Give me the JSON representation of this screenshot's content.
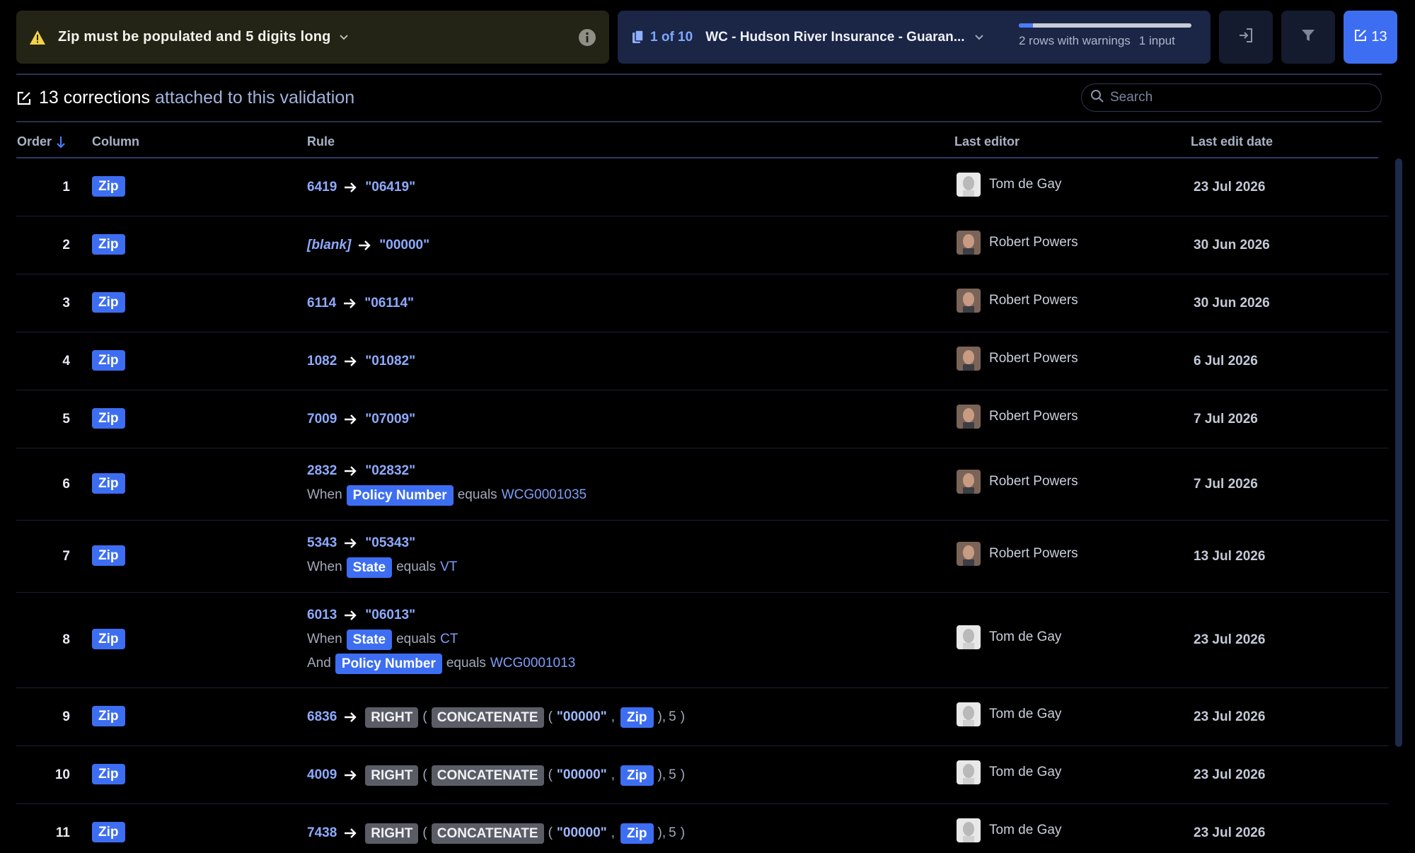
{
  "header": {
    "validation_message": "Zip must be populated and 5 digits long",
    "file_index": "1 of 10",
    "file_name": "WC - Hudson River Insurance - Guaran...",
    "progress_fraction": 0.08,
    "rows_with_warnings": "2 rows with warnings",
    "inputs": "1 input",
    "corrections_count": "13"
  },
  "subheader": {
    "count_text": "13 corrections",
    "rest_text": "attached to this validation",
    "search_placeholder": "Search"
  },
  "table": {
    "columns": {
      "order": "Order",
      "column": "Column",
      "rule": "Rule",
      "editor": "Last editor",
      "date": "Last edit date"
    },
    "rows": [
      {
        "order": "1",
        "column": "Zip",
        "from": "6419",
        "to": "\"06419\"",
        "editor": "Tom de Gay",
        "date": "23 Jul 2026"
      },
      {
        "order": "2",
        "column": "Zip",
        "from": "[blank]",
        "to": "\"00000\"",
        "editor": "Robert Powers",
        "date": "30 Jun 2026"
      },
      {
        "order": "3",
        "column": "Zip",
        "from": "6114",
        "to": "\"06114\"",
        "editor": "Robert Powers",
        "date": "30 Jun 2026"
      },
      {
        "order": "4",
        "column": "Zip",
        "from": "1082",
        "to": "\"01082\"",
        "editor": "Robert Powers",
        "date": "6 Jul 2026"
      },
      {
        "order": "5",
        "column": "Zip",
        "from": "7009",
        "to": "\"07009\"",
        "editor": "Robert Powers",
        "date": "7 Jul 2026"
      },
      {
        "order": "6",
        "column": "Zip",
        "from": "2832",
        "to": "\"02832\"",
        "when_word": "When",
        "when_field": "Policy Number",
        "when_op": "equals",
        "when_value": "WCG0001035",
        "editor": "Robert Powers",
        "date": "7 Jul 2026"
      },
      {
        "order": "7",
        "column": "Zip",
        "from": "5343",
        "to": "\"05343\"",
        "when_word": "When",
        "when_field": "State",
        "when_op": "equals",
        "when_value": "VT",
        "editor": "Robert Powers",
        "date": "13 Jul 2026"
      },
      {
        "order": "8",
        "column": "Zip",
        "from": "6013",
        "to": "\"06013\"",
        "when_word": "When",
        "when_field": "State",
        "when_op": "equals",
        "when_value": "CT",
        "and_word": "And",
        "and_field": "Policy Number",
        "and_op": "equals",
        "and_value": "WCG0001013",
        "editor": "Tom de Gay",
        "date": "23 Jul 2026"
      },
      {
        "order": "9",
        "column": "Zip",
        "from": "6836",
        "fn_outer": "RIGHT",
        "fn_inner": "CONCATENATE",
        "fn_str": "\"00000\"",
        "fn_field": "Zip",
        "fn_num": "5",
        "editor": "Tom de Gay",
        "date": "23 Jul 2026"
      },
      {
        "order": "10",
        "column": "Zip",
        "from": "4009",
        "fn_outer": "RIGHT",
        "fn_inner": "CONCATENATE",
        "fn_str": "\"00000\"",
        "fn_field": "Zip",
        "fn_num": "5",
        "editor": "Tom de Gay",
        "date": "23 Jul 2026"
      },
      {
        "order": "11",
        "column": "Zip",
        "from": "7438",
        "fn_outer": "RIGHT",
        "fn_inner": "CONCATENATE",
        "fn_str": "\"00000\"",
        "fn_field": "Zip",
        "fn_num": "5",
        "editor": "Tom de Gay",
        "date": "23 Jul 2026"
      }
    ]
  },
  "icons": {
    "warning": "warning-icon",
    "info": "info-icon",
    "files": "files-icon",
    "login": "login-icon",
    "filter": "filter-icon",
    "corrections": "edit-icon",
    "search": "search-icon",
    "sort": "arrow-down-icon"
  },
  "colors": {
    "accent": "#3d6ef2",
    "warning_panel": "#242416",
    "file_panel": "#1b2545",
    "value_text": "#8eaaff"
  }
}
